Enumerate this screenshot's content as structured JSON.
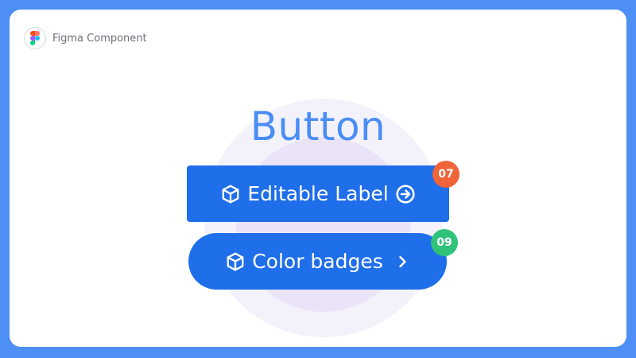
{
  "brand": {
    "label": "Figma Component",
    "icon": "figma-logo-icon"
  },
  "title": "Button",
  "buttons": [
    {
      "label": "Editable Label",
      "left_icon": "cube-icon",
      "right_icon": "arrow-right-circle-icon",
      "badge": "07",
      "badge_color": "#f0643a"
    },
    {
      "label": "Color badges",
      "left_icon": "cube-icon",
      "right_icon": "chevron-right-icon",
      "badge": "09",
      "badge_color": "#2fc37a"
    }
  ],
  "colors": {
    "page_background": "#4d8ff5",
    "card_background": "#ffffff",
    "title": "#4a8df5",
    "button": "#1f6eea",
    "halo_outer": "#f3f2fb",
    "halo_inner": "#ebe4f8"
  }
}
